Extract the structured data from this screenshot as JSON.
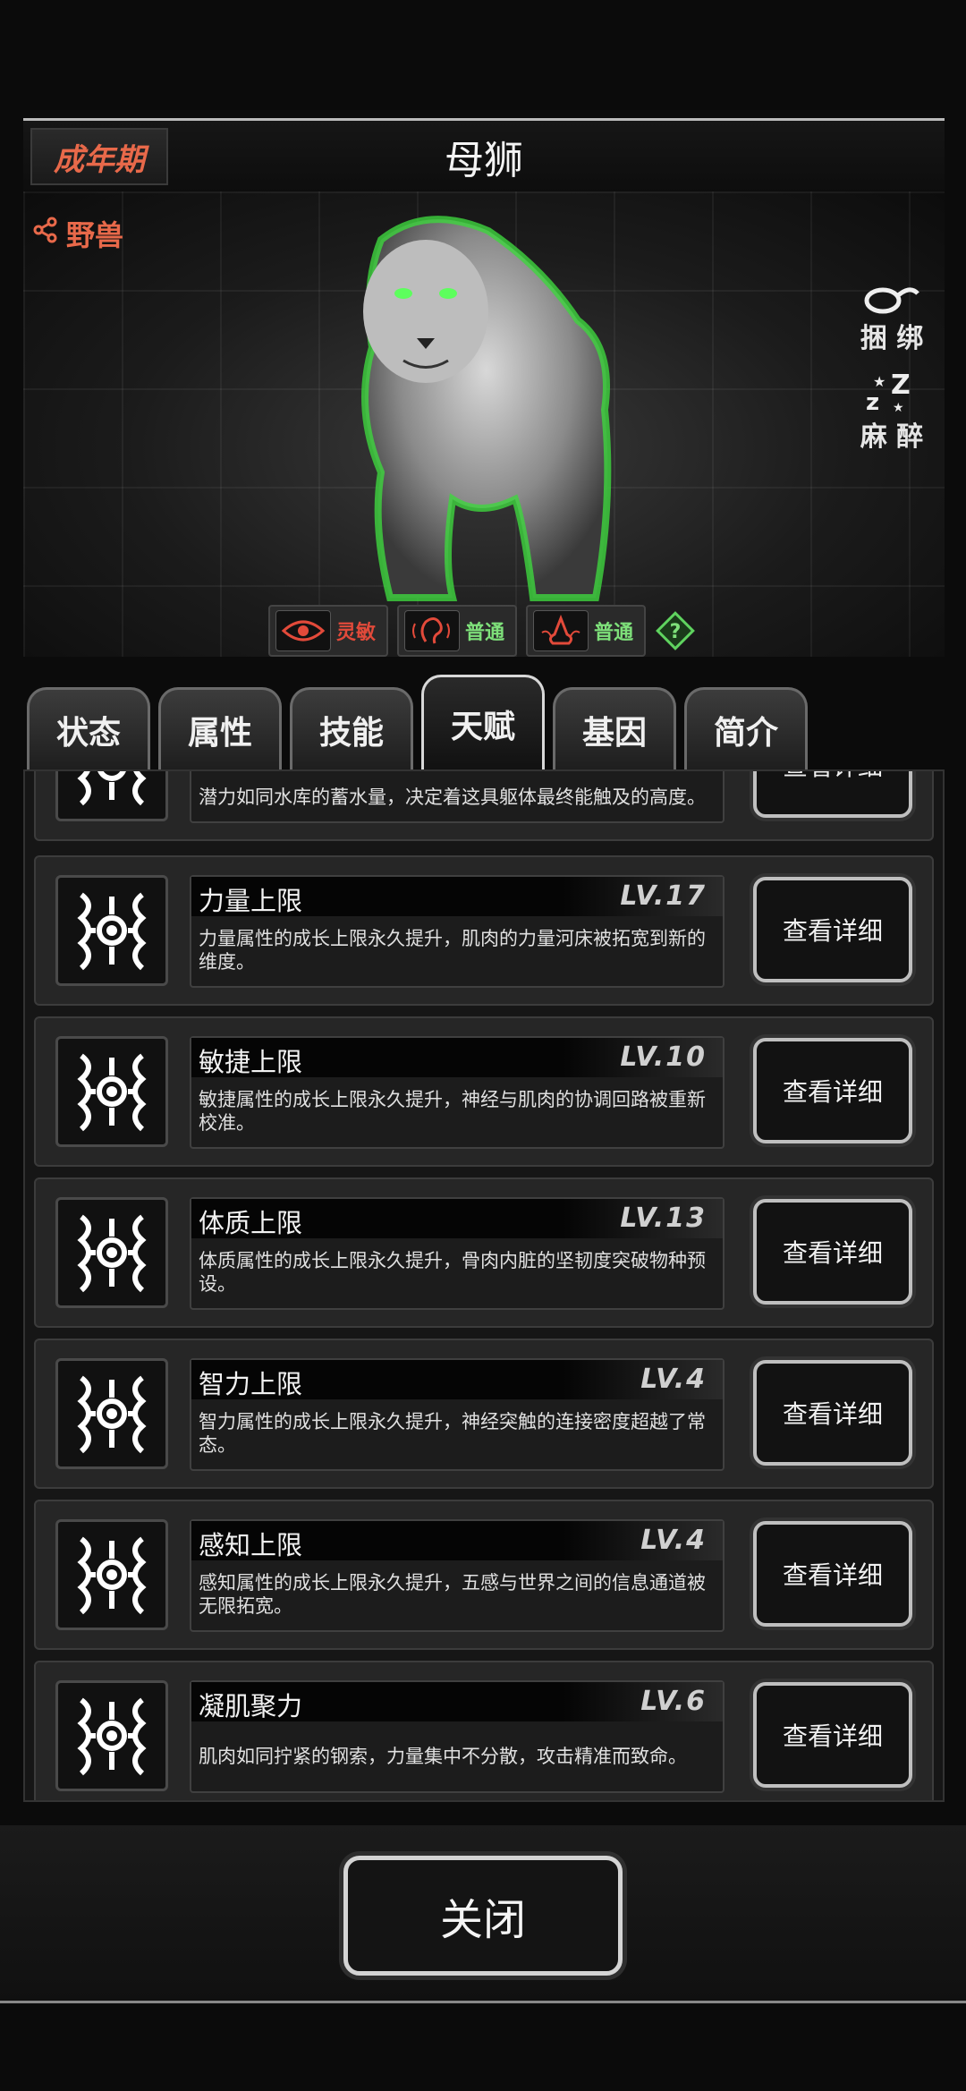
{
  "header": {
    "stage": "成年期",
    "name": "母狮"
  },
  "portrait": {
    "category": "野兽",
    "actions": [
      {
        "label_1": "捆",
        "label_2": "绑",
        "icon": "rope-icon"
      },
      {
        "label_1": "麻",
        "label_2": "醉",
        "icon": "sleep-icon"
      }
    ],
    "traits": [
      {
        "icon": "eye-icon",
        "label": "灵敏",
        "color": "#e24a3a"
      },
      {
        "icon": "ear-icon",
        "label": "普通",
        "color": "#7ee07a"
      },
      {
        "icon": "nose-icon",
        "label": "普通",
        "color": "#7ee07a"
      }
    ],
    "help_label": "?"
  },
  "tabs": [
    {
      "label": "状态",
      "active": false
    },
    {
      "label": "属性",
      "active": false
    },
    {
      "label": "技能",
      "active": false
    },
    {
      "label": "天赋",
      "active": true
    },
    {
      "label": "基因",
      "active": false
    },
    {
      "label": "简介",
      "active": false
    }
  ],
  "talents": [
    {
      "title": "",
      "level": "",
      "desc": "潜力如同水库的蓄水量，决定着这具躯体最终能触及的高度。",
      "button": "查看详细"
    },
    {
      "title": "力量上限",
      "level": "LV.17",
      "desc": "力量属性的成长上限永久提升，肌肉的力量河床被拓宽到新的维度。",
      "button": "查看详细"
    },
    {
      "title": "敏捷上限",
      "level": "LV.10",
      "desc": "敏捷属性的成长上限永久提升，神经与肌肉的协调回路被重新校准。",
      "button": "查看详细"
    },
    {
      "title": "体质上限",
      "level": "LV.13",
      "desc": "体质属性的成长上限永久提升，骨肉内脏的坚韧度突破物种预设。",
      "button": "查看详细"
    },
    {
      "title": "智力上限",
      "level": "LV.4",
      "desc": "智力属性的成长上限永久提升，神经突触的连接密度超越了常态。",
      "button": "查看详细"
    },
    {
      "title": "感知上限",
      "level": "LV.4",
      "desc": "感知属性的成长上限永久提升，五感与世界之间的信息通道被无限拓宽。",
      "button": "查看详细"
    },
    {
      "title": "凝肌聚力",
      "level": "LV.6",
      "desc": "肌肉如同拧紧的钢索，力量集中不分散，攻击精准而致命。",
      "button": "查看详细"
    }
  ],
  "footer": {
    "close_label": "关闭"
  }
}
